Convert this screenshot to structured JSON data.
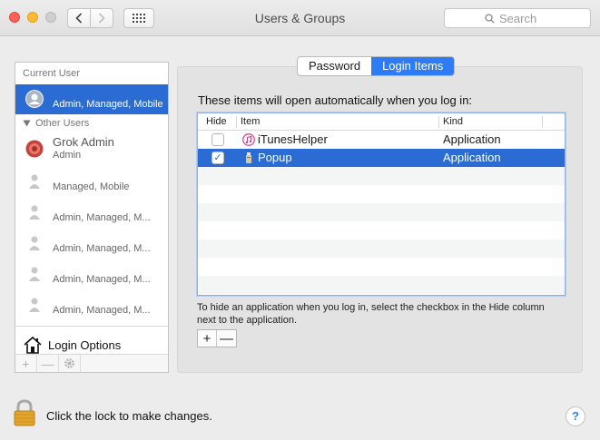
{
  "window": {
    "title": "Users & Groups",
    "search_placeholder": "Search"
  },
  "sidebar": {
    "current_user_header": "Current User",
    "current_user": {
      "role": "Admin, Managed, Mobile"
    },
    "other_users_header": "Other Users",
    "other_users": [
      {
        "name": "Grok Admin",
        "role": "Admin"
      },
      {
        "name": "",
        "role": "Managed, Mobile"
      },
      {
        "name": "",
        "role": "Admin, Managed, M..."
      },
      {
        "name": "",
        "role": "Admin, Managed, M..."
      },
      {
        "name": "",
        "role": "Admin, Managed, M..."
      },
      {
        "name": "",
        "role": "Admin, Managed, M..."
      }
    ],
    "login_options_label": "Login Options",
    "toolbar": {
      "add": "+",
      "remove": "—",
      "action_icon": "gear-icon"
    }
  },
  "tabs": [
    {
      "label": "Password",
      "active": false
    },
    {
      "label": "Login Items",
      "active": true
    }
  ],
  "login_items": {
    "intro": "These items will open automatically when you log in:",
    "columns": {
      "hide": "Hide",
      "item": "Item",
      "kind": "Kind"
    },
    "rows": [
      {
        "hidden": false,
        "name": "iTunesHelper",
        "kind": "Application",
        "icon": "itunes-icon"
      },
      {
        "hidden": true,
        "name": "Popup",
        "kind": "Application",
        "icon": "popup-app-icon",
        "selected": true
      }
    ],
    "hint": "To hide an application when you log in, select the checkbox in the Hide column next to the application.",
    "add_label": "+",
    "remove_label": "—"
  },
  "footer": {
    "lock_text": "Click the lock to make changes.",
    "help_label": "?"
  },
  "colors": {
    "selection": "#2b6cd4",
    "accent": "#2d7cf5"
  }
}
